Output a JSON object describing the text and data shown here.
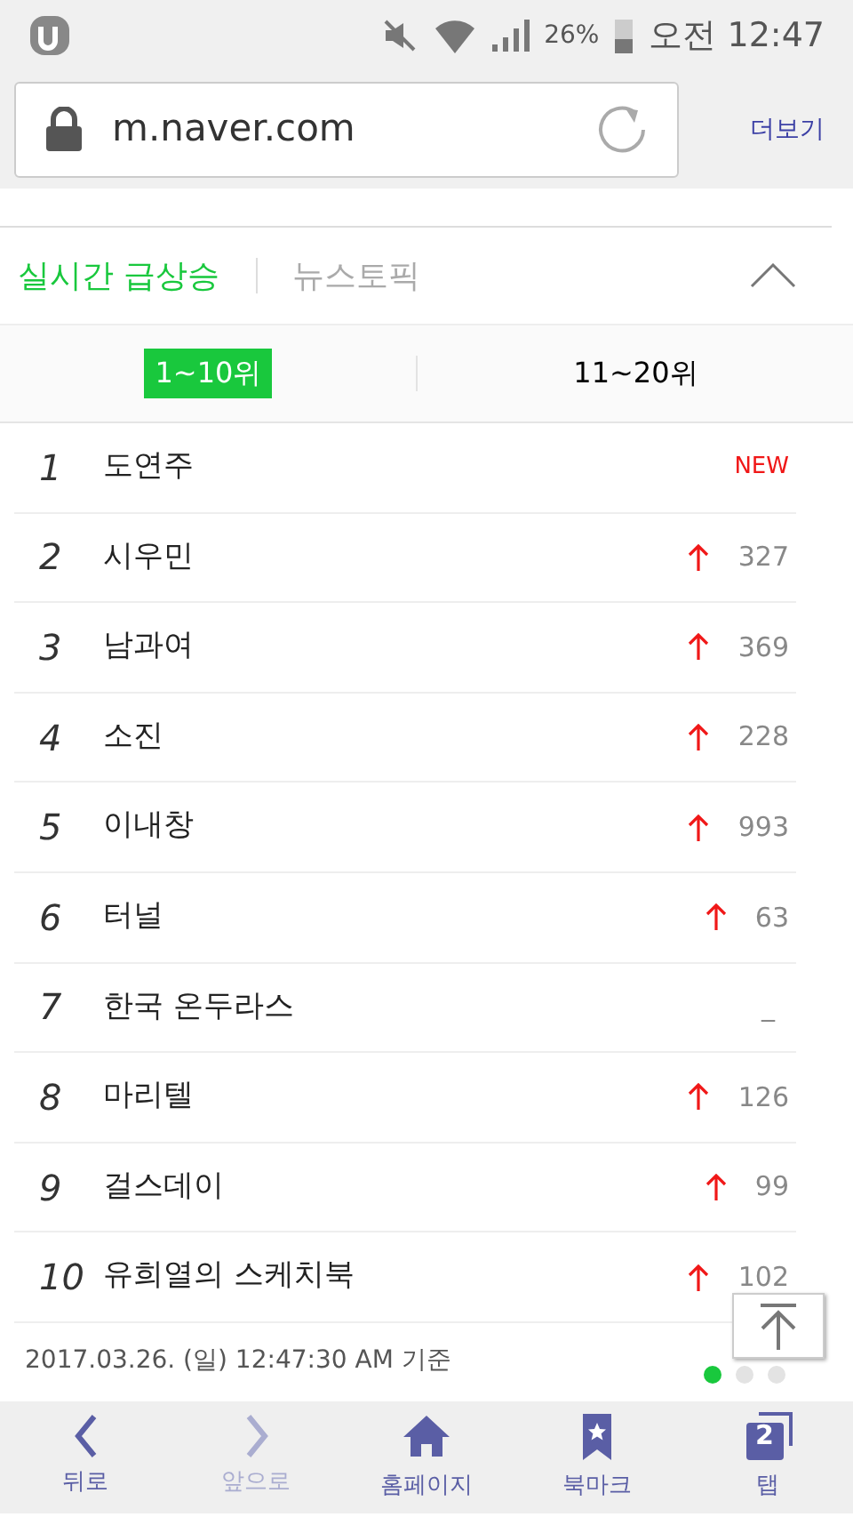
{
  "status_bar": {
    "battery": "26%",
    "time": "오전 12:47"
  },
  "browser_bar": {
    "url": "m.naver.com",
    "more": "더보기"
  },
  "section_tabs": [
    {
      "label": "실시간 급상승",
      "selected": true
    },
    {
      "label": "뉴스토픽",
      "selected": false
    }
  ],
  "range_tabs": [
    {
      "label": "1~10위",
      "selected": true
    },
    {
      "label": "11~20위",
      "selected": false
    }
  ],
  "rankings": [
    {
      "rank": "1",
      "name": "도연주",
      "kind": "new",
      "change": "NEW"
    },
    {
      "rank": "2",
      "name": "시우민",
      "kind": "up",
      "change": "327"
    },
    {
      "rank": "3",
      "name": "남과여",
      "kind": "up",
      "change": "369"
    },
    {
      "rank": "4",
      "name": "소진",
      "kind": "up",
      "change": "228"
    },
    {
      "rank": "5",
      "name": "이내창",
      "kind": "up",
      "change": "993"
    },
    {
      "rank": "6",
      "name": "터널",
      "kind": "up",
      "change": "63"
    },
    {
      "rank": "7",
      "name": "한국 온두라스",
      "kind": "same",
      "change": "_"
    },
    {
      "rank": "8",
      "name": "마리텔",
      "kind": "up",
      "change": "126"
    },
    {
      "rank": "9",
      "name": "걸스데이",
      "kind": "up",
      "change": "99"
    },
    {
      "rank": "10",
      "name": "유희열의 스케치북",
      "kind": "up",
      "change": "102"
    }
  ],
  "timestamp": "2017.03.26. (일) 12:47:30 AM 기준",
  "pages": [
    {
      "selected": true
    },
    {
      "selected": false
    },
    {
      "selected": false
    }
  ],
  "bottom_nav": [
    {
      "kind": "back",
      "label": "뒤로",
      "disabled": false
    },
    {
      "kind": "forward",
      "label": "앞으로",
      "disabled": true
    },
    {
      "kind": "home",
      "label": "홈페이지",
      "disabled": false
    },
    {
      "kind": "bookmark",
      "label": "북마크",
      "disabled": false
    },
    {
      "kind": "tabs",
      "label": "탭",
      "count": "2",
      "disabled": false
    }
  ]
}
